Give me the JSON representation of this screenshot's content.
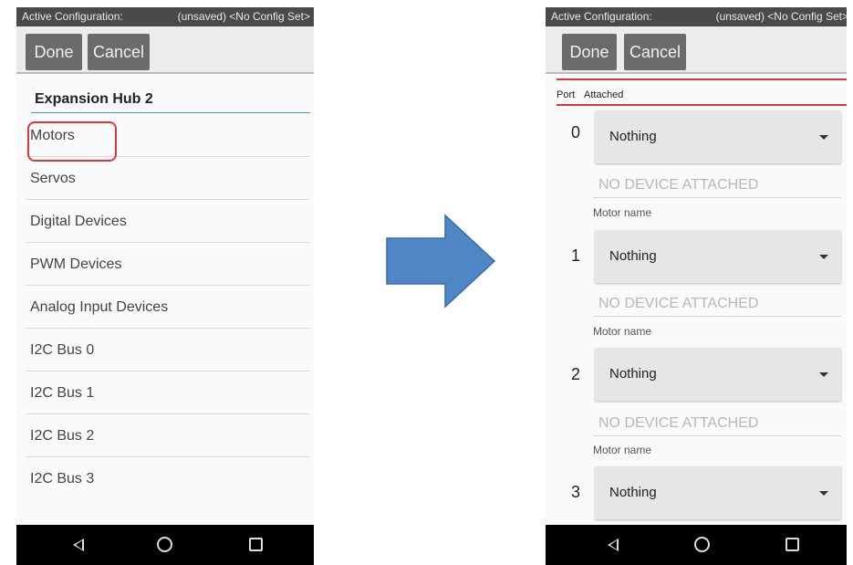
{
  "left_screen": {
    "status_left": "Active Configuration:",
    "status_right": "(unsaved) <No Config Set>",
    "done_label": "Done",
    "cancel_label": "Cancel",
    "hub_name": "Expansion Hub 2",
    "menu_items": [
      {
        "label": "Motors"
      },
      {
        "label": "Servos"
      },
      {
        "label": "Digital Devices"
      },
      {
        "label": "PWM Devices"
      },
      {
        "label": "Analog Input Devices"
      },
      {
        "label": "I2C Bus 0"
      },
      {
        "label": "I2C Bus 1"
      },
      {
        "label": "I2C Bus 2"
      },
      {
        "label": "I2C Bus 3"
      }
    ]
  },
  "arrow": {
    "color": "#4f86c6",
    "icon": "right-arrow-icon"
  },
  "right_screen": {
    "status_left": "Active Configuration:",
    "status_right": "(unsaved) <No Config Set>",
    "done_label": "Done",
    "cancel_label": "Cancel",
    "port_header": "Port",
    "attached_header": "Attached",
    "ports": [
      {
        "number": "0",
        "selection": "Nothing",
        "name_placeholder": "NO DEVICE ATTACHED",
        "name_label": "Motor name"
      },
      {
        "number": "1",
        "selection": "Nothing",
        "name_placeholder": "NO DEVICE ATTACHED",
        "name_label": "Motor name"
      },
      {
        "number": "2",
        "selection": "Nothing",
        "name_placeholder": "NO DEVICE ATTACHED",
        "name_label": "Motor name"
      },
      {
        "number": "3",
        "selection": "Nothing"
      }
    ]
  },
  "colors": {
    "highlight": "#d9383a",
    "accent_underline": "#3aa3c0",
    "button_bg": "#6b6b6b"
  },
  "navbar": {
    "icons": [
      "back-icon",
      "home-icon",
      "recents-icon"
    ]
  }
}
